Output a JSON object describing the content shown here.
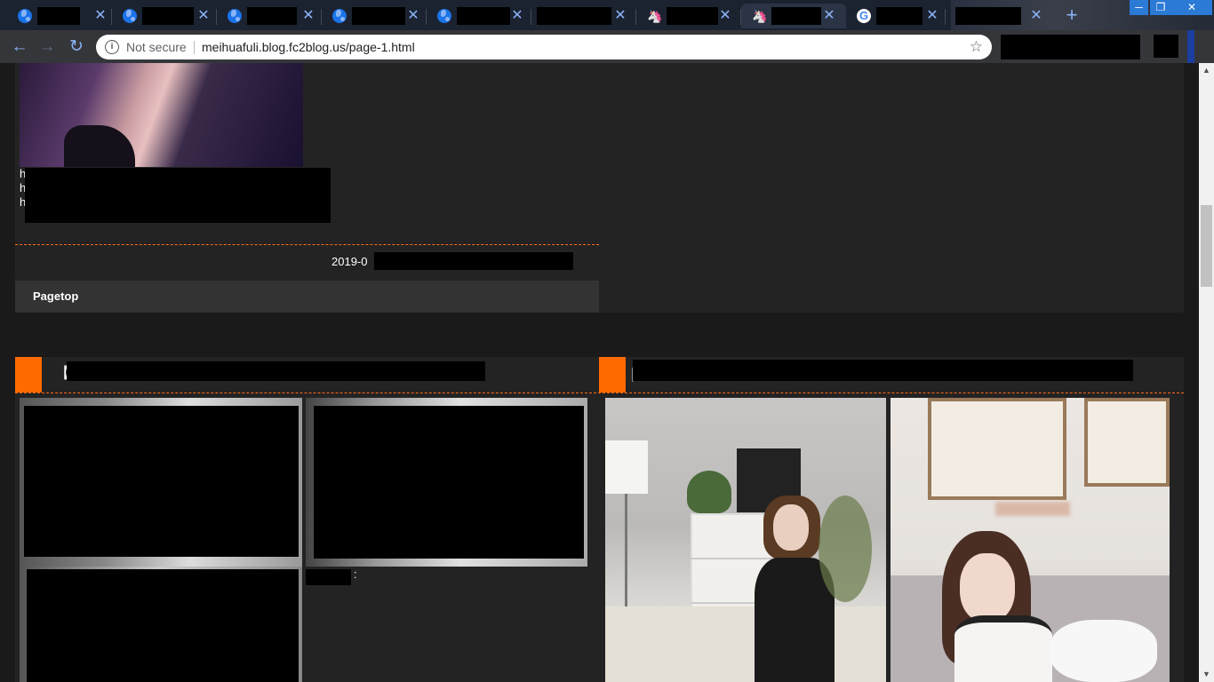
{
  "window": {
    "tabs": [
      {
        "favicon": "globe-icon"
      },
      {
        "favicon": "globe-icon"
      },
      {
        "favicon": "globe-icon"
      },
      {
        "favicon": "globe-icon"
      },
      {
        "favicon": "globe-icon"
      },
      {
        "favicon": "none"
      },
      {
        "favicon": "unicorn-icon"
      },
      {
        "favicon": "unicorn-icon"
      },
      {
        "favicon": "google-icon"
      },
      {
        "favicon": "none"
      }
    ],
    "close_glyph": "✕",
    "newtab_glyph": "+",
    "min_glyph": "─",
    "max_glyph": "❐",
    "winclose_glyph": "✕"
  },
  "toolbar": {
    "back_glyph": "←",
    "forward_glyph": "→",
    "reload_glyph": "↻",
    "security_label": "Not secure",
    "url": "meihuafuli.blog.fc2blog.us/page-1.html",
    "star_glyph": "☆",
    "info_glyph": "i"
  },
  "post": {
    "text_lines": [
      "h",
      "h",
      "h"
    ],
    "date_prefix": "2019-0",
    "pagetop_label": "Pagetop",
    "entry1_title_start": "【",
    "entry2_title_start": "|",
    "caption_suffix": ":"
  },
  "scrollbar": {
    "up_glyph": "▲",
    "down_glyph": "▼"
  },
  "colors": {
    "accent": "#ff6a00",
    "panel": "#232323",
    "page_bg": "#1a1a1a",
    "tab_icon": "#8ab4f8"
  }
}
